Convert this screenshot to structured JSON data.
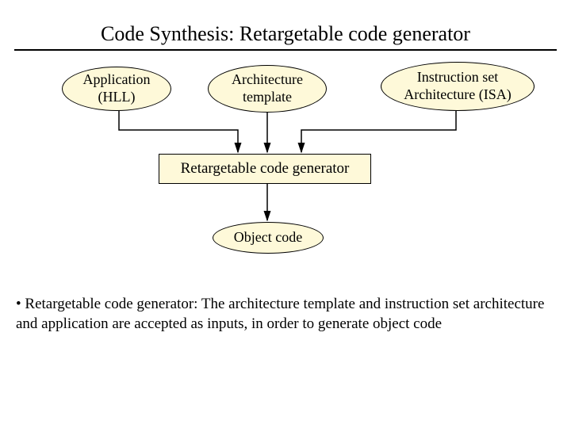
{
  "title": "Code Synthesis: Retargetable code generator",
  "nodes": {
    "app": "Application\n(HLL)",
    "arch": "Architecture\ntemplate",
    "isa": "Instruction set\nArchitecture (ISA)",
    "gen": "Retargetable code generator",
    "obj": "Object code"
  },
  "bullet": "• Retargetable code generator: The architecture template and instruction set architecture and application are accepted as inputs, in order to generate object code"
}
